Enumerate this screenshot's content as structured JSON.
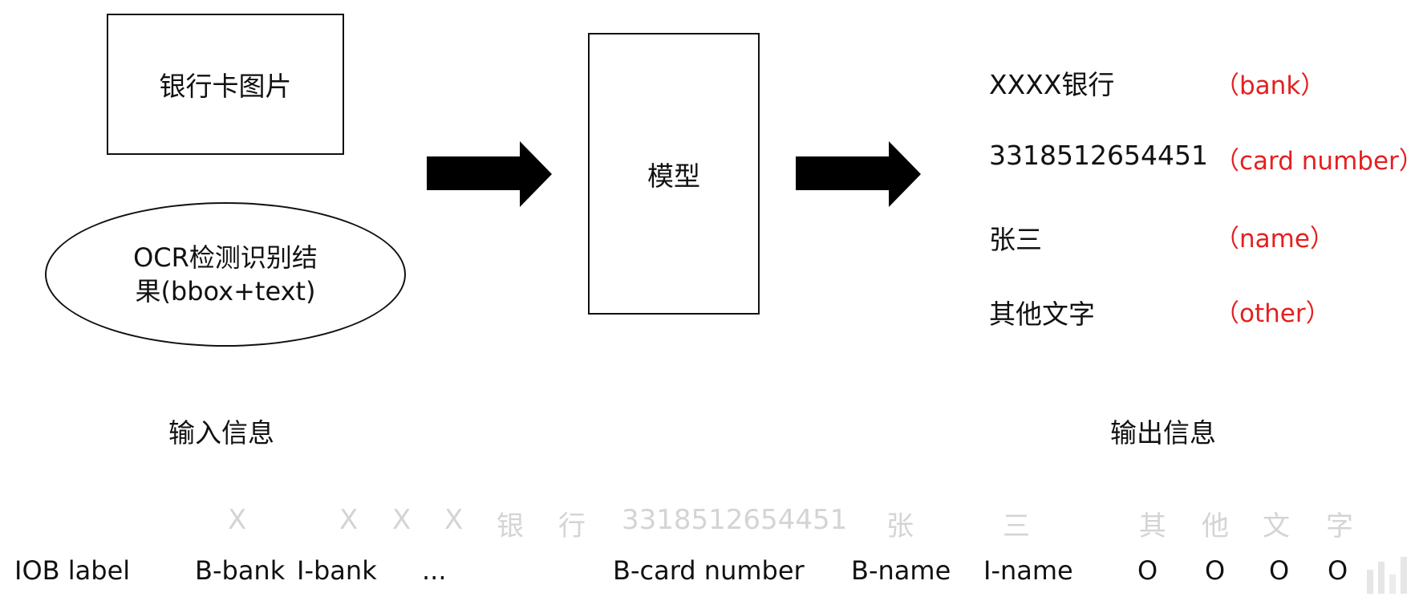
{
  "input": {
    "image_box_label": "银行卡图片",
    "ocr_line1": "OCR检测识别结",
    "ocr_line2": "果(bbox+text)",
    "caption": "输入信息"
  },
  "model": {
    "label": "模型"
  },
  "output": {
    "caption": "输出信息",
    "rows": [
      {
        "text": "XXXX银行",
        "tag": "（bank）"
      },
      {
        "text": "3318512654451",
        "tag": "（card number）"
      },
      {
        "text": "张三",
        "tag": "（name）"
      },
      {
        "text": "其他文字",
        "tag": "（other）"
      }
    ]
  },
  "tokens": [
    "X",
    "X",
    "X",
    "X",
    "银",
    "行",
    "3318512654451",
    "张",
    "三",
    "其",
    "他",
    "文",
    "字"
  ],
  "iob": {
    "header": "IOB label",
    "labels": [
      "B-bank",
      "I-bank",
      "...",
      "B-card number",
      "B-name",
      "I-name",
      "O",
      "O",
      "O",
      "O"
    ]
  },
  "colors": {
    "tag_red": "#e32020",
    "faded_token": "#d4d4d4",
    "ink": "#111111"
  }
}
